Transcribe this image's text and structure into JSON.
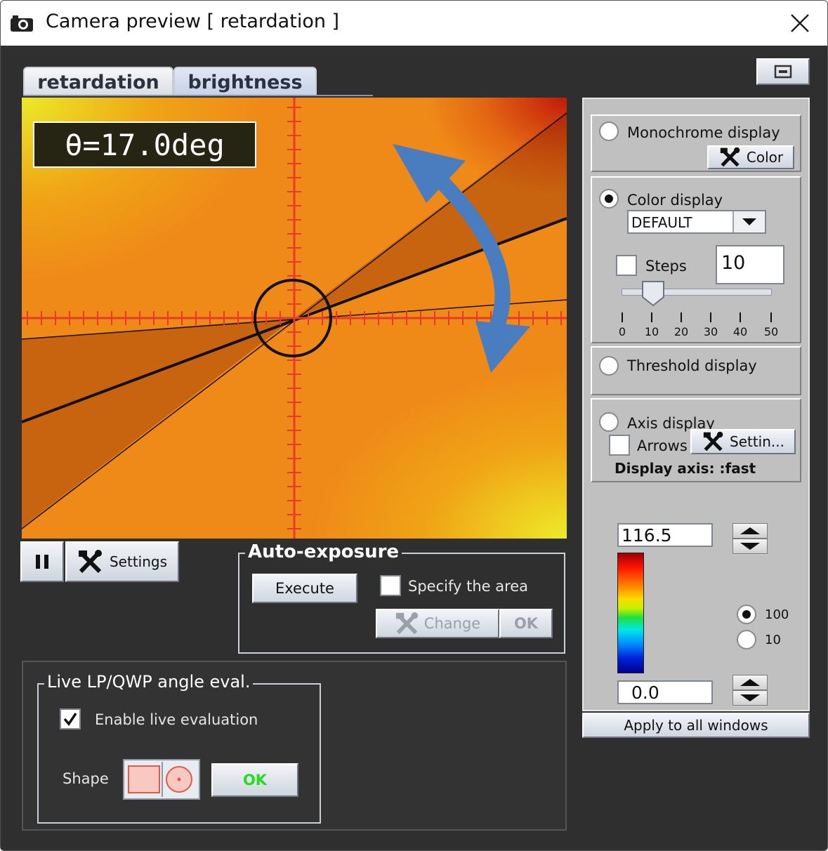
{
  "window": {
    "title": "Camera preview [ retardation ]",
    "icons": {
      "app": "camera-icon",
      "close": "close-icon",
      "minimize": "minimize-icon"
    }
  },
  "tabs": [
    {
      "label": "retardation",
      "active": true
    },
    {
      "label": "brightness",
      "active": false
    }
  ],
  "image": {
    "angle_readout": "θ=17.0deg",
    "overlay_color": "#e8392a",
    "arrow_color": "#4a7cc0"
  },
  "controls": {
    "pause_icon": "pause-icon",
    "settings_label": "Settings",
    "settings_icon": "tools-icon"
  },
  "auto_exposure": {
    "title": "Auto-exposure",
    "execute_label": "Execute",
    "specify_area_label": "Specify the area",
    "specify_area_checked": false,
    "change_label": "Change",
    "ok_label": "OK"
  },
  "live_eval": {
    "title": "Live LP/QWP angle eval.",
    "enable_label": "Enable live evaluation",
    "enable_checked": true,
    "shape_label": "Shape",
    "ok_label": "OK",
    "ok_color": "#22dd22"
  },
  "display_panel": {
    "monochrome": {
      "label": "Monochrome display",
      "selected": false,
      "color_button": "Color"
    },
    "color": {
      "label": "Color display",
      "selected": true,
      "palette_value": "DEFAULT",
      "steps_label": "Steps",
      "steps_checked": false,
      "steps_value": "10",
      "slider_level": 5,
      "slider_ticks": [
        "0",
        "10",
        "20",
        "30",
        "40",
        "50"
      ]
    },
    "threshold": {
      "label": "Threshold display",
      "selected": false
    },
    "axis": {
      "label": "Axis display",
      "selected": false,
      "arrows_label": "Arrows",
      "arrows_checked": false,
      "settings_button": "Settin...",
      "display_axis_text": "Display axis: :fast"
    },
    "scale": {
      "max_value": "116.5",
      "min_value": "0.0",
      "option_100": "100",
      "option_10": "10",
      "selected_option": "100"
    },
    "apply_label": "Apply to all windows"
  }
}
